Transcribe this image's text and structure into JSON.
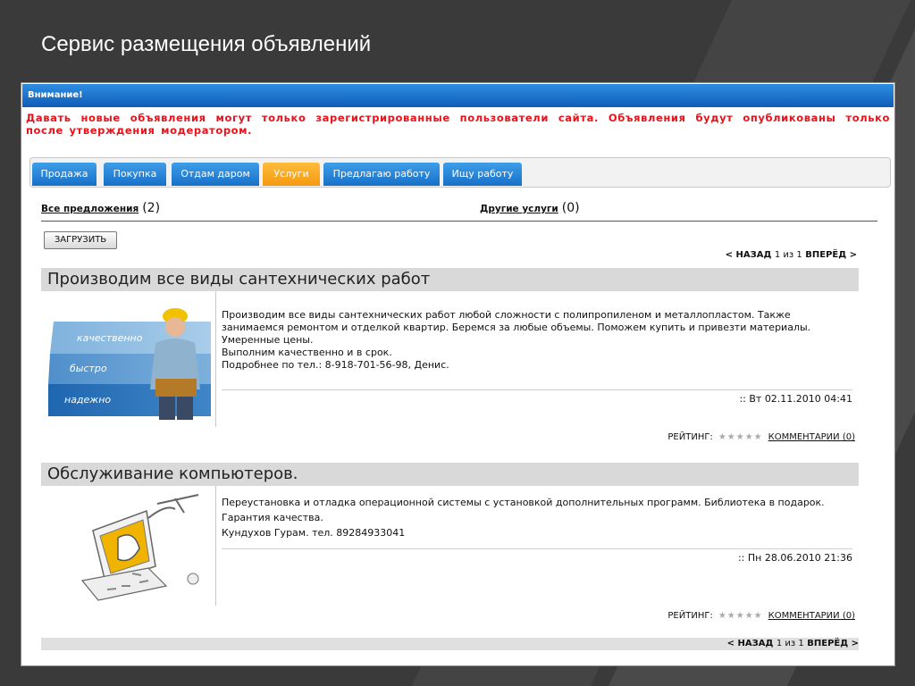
{
  "slide": {
    "title": "Сервис размещения объявлений"
  },
  "notice": {
    "header": "Внимание!",
    "text": "Давать новые объявления могут только зарегистрированные пользователи сайта. Объявления будут опубликованы только после утверждения модератором."
  },
  "tabs": [
    {
      "label": "Продажа"
    },
    {
      "label": "Покупка"
    },
    {
      "label": "Отдам даром"
    },
    {
      "label": "Услуги"
    },
    {
      "label": "Предлагаю работу"
    },
    {
      "label": "Ищу работу"
    }
  ],
  "filters": {
    "all": {
      "label": "Все предложения",
      "count": "(2)"
    },
    "other": {
      "label": "Другие услуги",
      "count": "(0)"
    }
  },
  "upload_button": "ЗАГРУЗИТЬ",
  "pager": {
    "back": "< НАЗАД",
    "page_info": "1 из 1",
    "forward": "ВПЕРЁД >"
  },
  "listings": [
    {
      "title": "Производим все виды сантехнических работ",
      "image_labels": [
        "качественно",
        "быстро",
        "надежно"
      ],
      "description_lines": [
        "Производим все виды сантехнических работ любой сложности  с полипропиленом и металлопластом. Также",
        "занимаемся ремонтом и отделкой квартир. Беремся за любые объемы. Поможем купить и привезти материалы.",
        "Умеренные цены.",
        "Выполним качественно и в срок.",
        "Подробнее по тел.: 8-918-701-56-98, Денис."
      ],
      "date": ":: Вт 02.11.2010 04:41",
      "rating_label": "РЕЙТИНГ:",
      "stars": "★★★★★",
      "comments": "КОММЕНТАРИИ (0)"
    },
    {
      "title": "Обслуживание компьютеров.",
      "description_lines": [
        "Переустановка и отладка операционной системы с установкой дополнительных программ. Библиотека в подарок.",
        "Гарантия качества.",
        "Кундухов Гурам. тел. 89284933041"
      ],
      "date": ":: Пн 28.06.2010 21:36",
      "rating_label": "РЕЙТИНГ:",
      "stars": "★★★★★",
      "comments": "КОММЕНТАРИИ (0)"
    }
  ],
  "colors": {
    "tab_blue": "#1770c8",
    "tab_active": "#f49a10",
    "notice_red": "#e8141c",
    "header_blue": "#0e5cb8"
  }
}
